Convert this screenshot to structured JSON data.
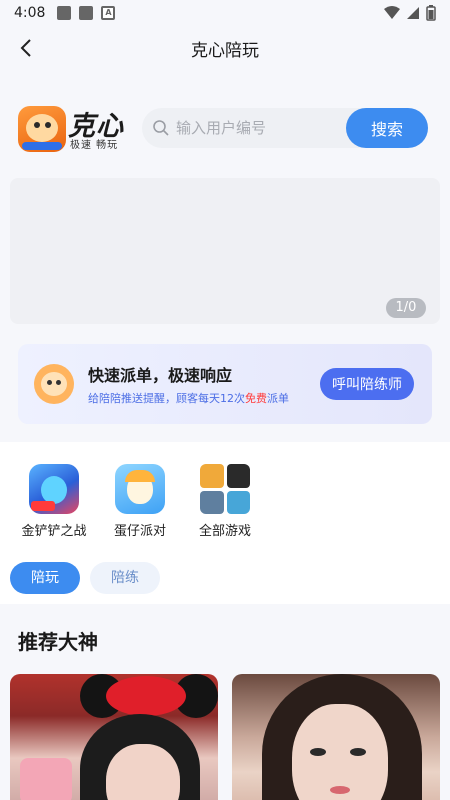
{
  "status_bar": {
    "time": "4:08"
  },
  "header": {
    "title": "克心陪玩"
  },
  "logo": {
    "main_text": "克心",
    "sub_text": "极速 畅玩"
  },
  "search": {
    "placeholder": "输入用户编号",
    "value": "",
    "button_label": "搜索"
  },
  "banner": {
    "indicator": "1/0"
  },
  "promo": {
    "title": "快速派单，极速响应",
    "subtitle_before": "给陪陪推送提醒，顾客每天12次",
    "subtitle_highlight": "免费",
    "subtitle_after": "派单",
    "button_label": "呼叫陪练师"
  },
  "games": [
    {
      "label": "金铲铲之战",
      "icon": "jinchanchan-game-icon"
    },
    {
      "label": "蛋仔派对",
      "icon": "eggy-party-game-icon"
    },
    {
      "label": "全部游戏",
      "icon": "all-games-grid-icon"
    }
  ],
  "tabs": [
    {
      "label": "陪玩",
      "active": true
    },
    {
      "label": "陪练",
      "active": false
    }
  ],
  "recommend": {
    "title": "推荐大神"
  },
  "colors": {
    "accent": "#3d8cf0",
    "promo_button": "#4c6ef0",
    "highlight": "#ff3b3b"
  }
}
